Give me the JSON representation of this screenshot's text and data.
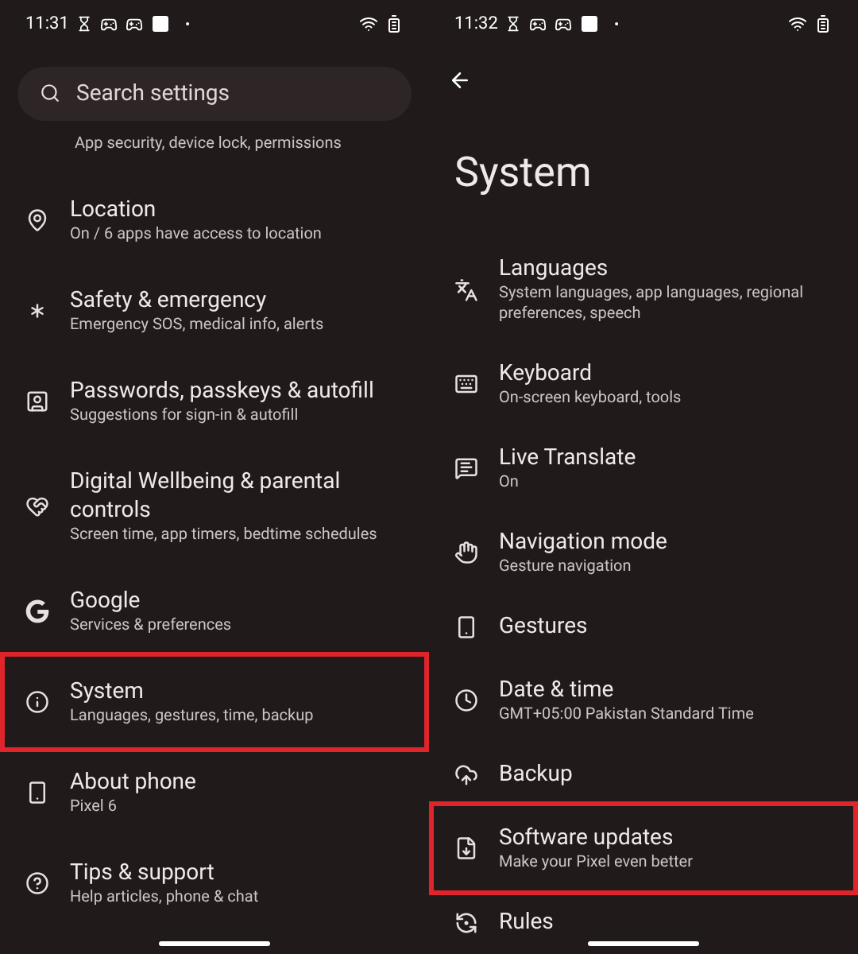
{
  "screens": [
    {
      "status_bar": {
        "time": "11:31"
      },
      "search": {
        "placeholder": "Search settings"
      },
      "partial_subtitle": "App security, device lock, permissions",
      "items": [
        {
          "title": "Location",
          "subtitle": "On / 6 apps have access to location",
          "highlighted": false
        },
        {
          "title": "Safety & emergency",
          "subtitle": "Emergency SOS, medical info, alerts",
          "highlighted": false
        },
        {
          "title": "Passwords, passkeys & autofill",
          "subtitle": "Suggestions for sign-in & autofill",
          "highlighted": false
        },
        {
          "title": "Digital Wellbeing & parental controls",
          "subtitle": "Screen time, app timers, bedtime schedules",
          "highlighted": false
        },
        {
          "title": "Google",
          "subtitle": "Services & preferences",
          "highlighted": false
        },
        {
          "title": "System",
          "subtitle": "Languages, gestures, time, backup",
          "highlighted": true
        },
        {
          "title": "About phone",
          "subtitle": "Pixel 6",
          "highlighted": false
        },
        {
          "title": "Tips & support",
          "subtitle": "Help articles, phone & chat",
          "highlighted": false
        }
      ]
    },
    {
      "status_bar": {
        "time": "11:32"
      },
      "title": "System",
      "items": [
        {
          "title": "Languages",
          "subtitle": "System languages, app languages, regional preferences, speech",
          "highlighted": false
        },
        {
          "title": "Keyboard",
          "subtitle": "On-screen keyboard, tools",
          "highlighted": false
        },
        {
          "title": "Live Translate",
          "subtitle": "On",
          "highlighted": false
        },
        {
          "title": "Navigation mode",
          "subtitle": "Gesture navigation",
          "highlighted": false
        },
        {
          "title": "Gestures",
          "highlighted": false
        },
        {
          "title": "Date & time",
          "subtitle": "GMT+05:00 Pakistan Standard Time",
          "highlighted": false
        },
        {
          "title": "Backup",
          "highlighted": false
        },
        {
          "title": "Software updates",
          "subtitle": "Make your Pixel even better",
          "highlighted": true
        },
        {
          "title": "Rules",
          "highlighted": false
        }
      ]
    }
  ]
}
